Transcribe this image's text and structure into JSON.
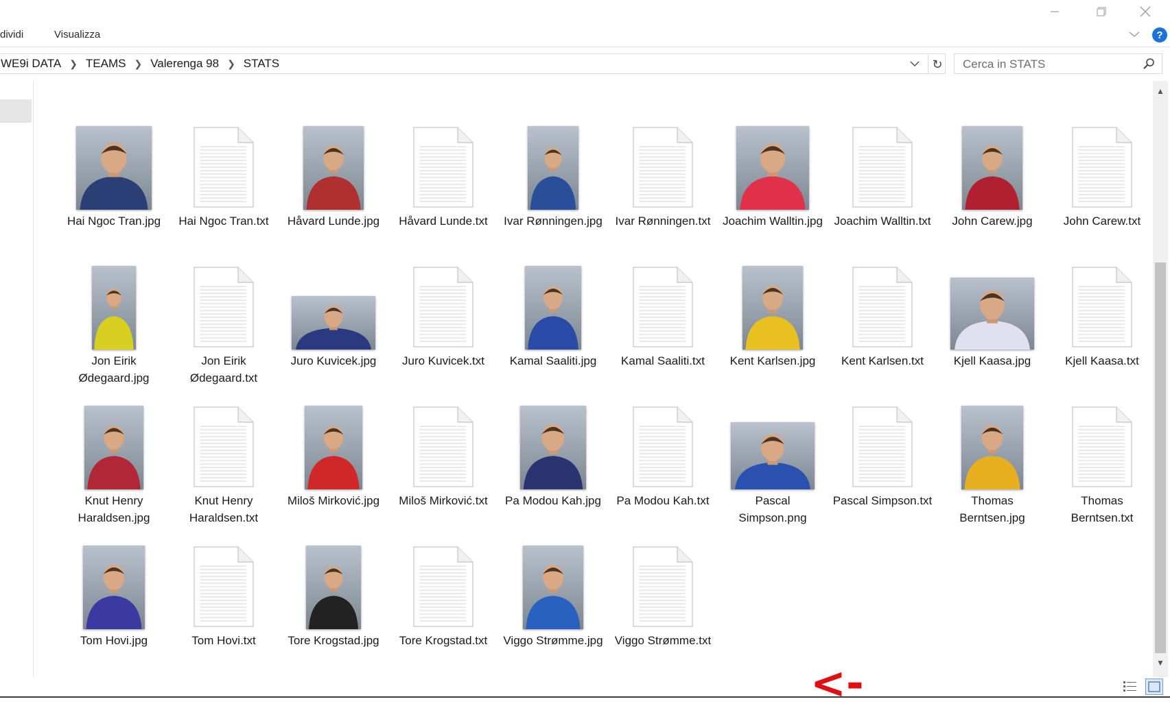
{
  "ribbon": {
    "tabs": [
      "dividi",
      "Visualizza"
    ]
  },
  "breadcrumb": [
    "WE9i DATA",
    "TEAMS",
    "Valerenga 98",
    "STATS"
  ],
  "search": {
    "placeholder": "Cerca in STATS"
  },
  "annotation": {
    "text": "<-",
    "color": "#e01010"
  },
  "colors": {
    "accent": "#1a73d9",
    "selection": "#e5e5e5"
  },
  "files": [
    {
      "name": "Hai Ngoc Tran.jpg",
      "type": "image",
      "kit": "#2a3f75"
    },
    {
      "name": "Hai Ngoc Tran.txt",
      "type": "text"
    },
    {
      "name": "Håvard Lunde.jpg",
      "type": "image",
      "kit": "#b03030"
    },
    {
      "name": "Håvard Lunde.txt",
      "type": "text"
    },
    {
      "name": "Ivar Rønningen.jpg",
      "type": "image",
      "kit": "#2a4f9a"
    },
    {
      "name": "Ivar Rønningen.txt",
      "type": "text"
    },
    {
      "name": "Joachim Walltin.jpg",
      "type": "image",
      "kit": "#e0304a"
    },
    {
      "name": "Joachim Walltin.txt",
      "type": "text"
    },
    {
      "name": "John Carew.jpg",
      "type": "image",
      "kit": "#b02030"
    },
    {
      "name": "John Carew.txt",
      "type": "text"
    },
    {
      "name": "Jon Eirik Ødegaard.jpg",
      "type": "image",
      "kit": "#d8d020"
    },
    {
      "name": "Jon Eirik Ødegaard.txt",
      "type": "text"
    },
    {
      "name": "Juro Kuvicek.jpg",
      "type": "image",
      "kit": "#2a3a80"
    },
    {
      "name": "Juro Kuvicek.txt",
      "type": "text"
    },
    {
      "name": "Kamal Saaliti.jpg",
      "type": "image",
      "kit": "#2a4aa8"
    },
    {
      "name": "Kamal Saaliti.txt",
      "type": "text"
    },
    {
      "name": "Kent Karlsen.jpg",
      "type": "image",
      "kit": "#e8c020"
    },
    {
      "name": "Kent Karlsen.txt",
      "type": "text"
    },
    {
      "name": "Kjell Kaasa.jpg",
      "type": "image",
      "kit": "#e0e0f0"
    },
    {
      "name": "Kjell Kaasa.txt",
      "type": "text"
    },
    {
      "name": "Knut Henry Haraldsen.jpg",
      "type": "image",
      "kit": "#b02838"
    },
    {
      "name": "Knut Henry Haraldsen.txt",
      "type": "text"
    },
    {
      "name": "Miloš Mirković.jpg",
      "type": "image",
      "kit": "#d02828"
    },
    {
      "name": "Miloš Mirković.txt",
      "type": "text"
    },
    {
      "name": "Pa Modou Kah.jpg",
      "type": "image",
      "kit": "#2a3470"
    },
    {
      "name": "Pa Modou Kah.txt",
      "type": "text"
    },
    {
      "name": "Pascal Simpson.png",
      "type": "image",
      "kit": "#2a50b0"
    },
    {
      "name": "Pascal Simpson.txt",
      "type": "text"
    },
    {
      "name": "Thomas Berntsen.jpg",
      "type": "image",
      "kit": "#e8b020"
    },
    {
      "name": "Thomas Berntsen.txt",
      "type": "text"
    },
    {
      "name": "Tom Hovi.jpg",
      "type": "image",
      "kit": "#3a3aa0"
    },
    {
      "name": "Tom Hovi.txt",
      "type": "text"
    },
    {
      "name": "Tore Krogstad.jpg",
      "type": "image",
      "kit": "#222222"
    },
    {
      "name": "Tore Krogstad.txt",
      "type": "text"
    },
    {
      "name": "Viggo Strømme.jpg",
      "type": "image",
      "kit": "#2a60c0"
    },
    {
      "name": "Viggo Strømme.txt",
      "type": "text"
    }
  ]
}
